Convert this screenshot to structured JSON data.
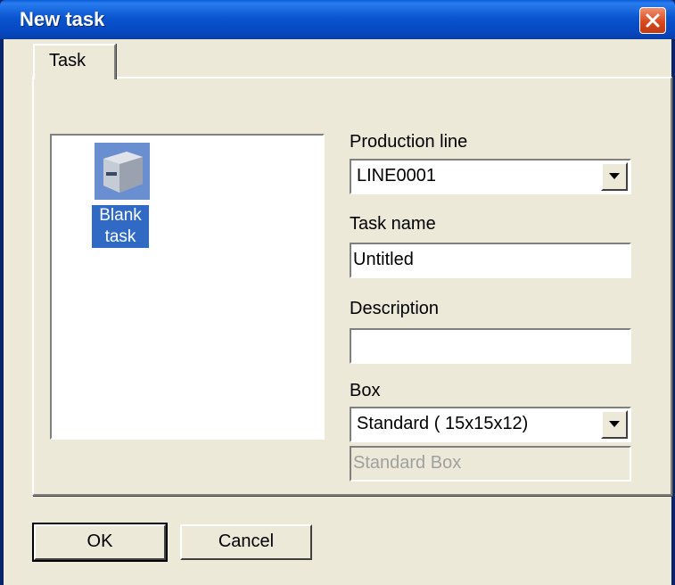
{
  "window": {
    "title": "New task"
  },
  "tabs": [
    {
      "label": "Task"
    }
  ],
  "list": {
    "items": [
      {
        "label_line1": "Blank",
        "label_line2": "task",
        "icon": "box-icon"
      }
    ]
  },
  "form": {
    "production_line": {
      "label": "Production line",
      "value": "LINE0001"
    },
    "task_name": {
      "label": "Task name",
      "value": "Untitled"
    },
    "description": {
      "label": "Description",
      "value": ""
    },
    "box": {
      "label": "Box",
      "value": "Standard ( 15x15x12)",
      "detail": "Standard Box"
    }
  },
  "buttons": {
    "ok": "OK",
    "cancel": "Cancel"
  },
  "colors": {
    "titlebar": "#0a55d0",
    "selection": "#316ac5",
    "face": "#ece9d8",
    "close": "#d84a20"
  }
}
